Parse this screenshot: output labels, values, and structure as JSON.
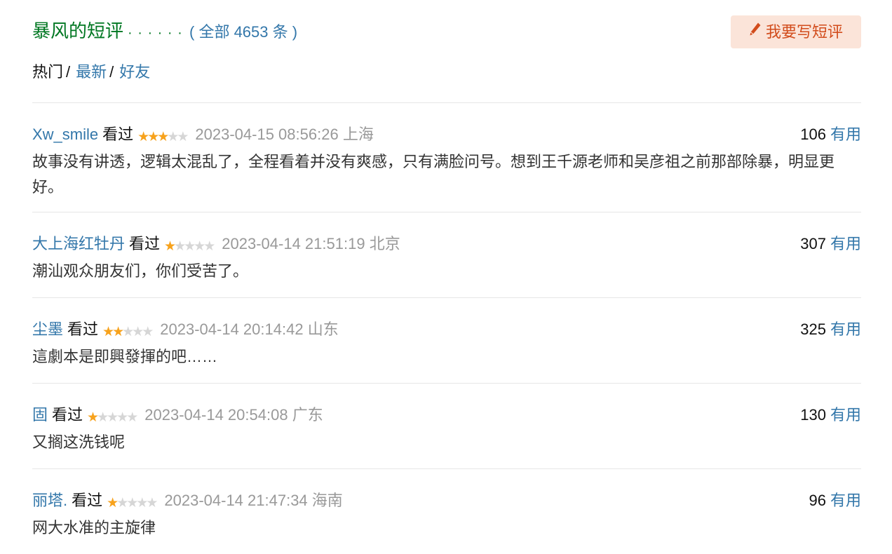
{
  "header": {
    "title": "暴风的短评",
    "dots": "· · · · · ·",
    "count_open": "(",
    "count_label": "全部 4653 条",
    "count_close": ")",
    "write_button": "我要写短评",
    "write_icon": "pencil-icon",
    "accent_color": "#007722",
    "link_color": "#3377aa",
    "button_bg": "#fbe4d9",
    "button_text_color": "#d24c1c"
  },
  "tabs": {
    "items": [
      {
        "label": "热门",
        "active": true
      },
      {
        "label": "最新",
        "active": false
      },
      {
        "label": "好友",
        "active": false
      }
    ],
    "separator": "/"
  },
  "comments": [
    {
      "user": "Xw_smile",
      "status": "看过",
      "rating": 3,
      "time": "2023-04-15 08:56:26",
      "location": "上海",
      "votes": "106",
      "useful_label": "有用",
      "content": "故事没有讲透，逻辑太混乱了，全程看着并没有爽感，只有满脸问号。想到王千源老师和吴彦祖之前那部除暴，明显更好。"
    },
    {
      "user": "大上海红牡丹",
      "status": "看过",
      "rating": 1,
      "time": "2023-04-14 21:51:19",
      "location": "北京",
      "votes": "307",
      "useful_label": "有用",
      "content": "潮汕观众朋友们，你们受苦了。"
    },
    {
      "user": "尘墨",
      "status": "看过",
      "rating": 2,
      "time": "2023-04-14 20:14:42",
      "location": "山东",
      "votes": "325",
      "useful_label": "有用",
      "content": "這劇本是即興發揮的吧……"
    },
    {
      "user": "固",
      "status": "看过",
      "rating": 1,
      "time": "2023-04-14 20:54:08",
      "location": "广东",
      "votes": "130",
      "useful_label": "有用",
      "content": "又搁这洗钱呢"
    },
    {
      "user": "丽塔.",
      "status": "看过",
      "rating": 1,
      "time": "2023-04-14 21:47:34",
      "location": "海南",
      "votes": "96",
      "useful_label": "有用",
      "content": "网大水准的主旋律"
    }
  ],
  "star_colors": {
    "on": "#f7a21c",
    "off": "#d6d6d6"
  },
  "max_rating": 5
}
